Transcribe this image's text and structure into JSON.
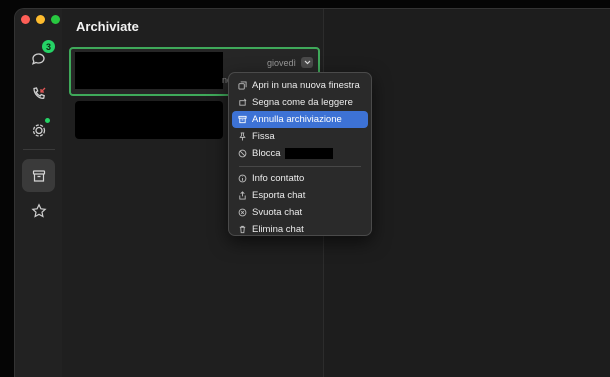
{
  "list": {
    "title": "Archiviate",
    "selected_chat": {
      "day": "giovedì",
      "preview_fragment": "nd"
    }
  },
  "rail": {
    "chats_badge": "3",
    "items": [
      "chats-icon",
      "calls-icon",
      "status-icon",
      "archive-icon",
      "starred-icon"
    ]
  },
  "menu": {
    "items": [
      {
        "label": "Apri in una nuova finestra",
        "icon": "new-window-icon"
      },
      {
        "label": "Segna come da leggere",
        "icon": "mark-unread-icon"
      },
      {
        "label": "Annulla archiviazione",
        "icon": "unarchive-icon",
        "highlighted": true
      },
      {
        "label": "Fissa",
        "icon": "pin-icon"
      },
      {
        "label": "Blocca",
        "icon": "block-icon"
      },
      {
        "label": "Info contatto",
        "icon": "info-icon"
      },
      {
        "label": "Esporta chat",
        "icon": "export-icon"
      },
      {
        "label": "Svuota chat",
        "icon": "clear-icon"
      },
      {
        "label": "Elimina chat",
        "icon": "trash-icon"
      }
    ]
  },
  "colors": {
    "accent": "#3d72d5",
    "brand_green": "#25d366",
    "selection_border": "#3fa95a"
  }
}
